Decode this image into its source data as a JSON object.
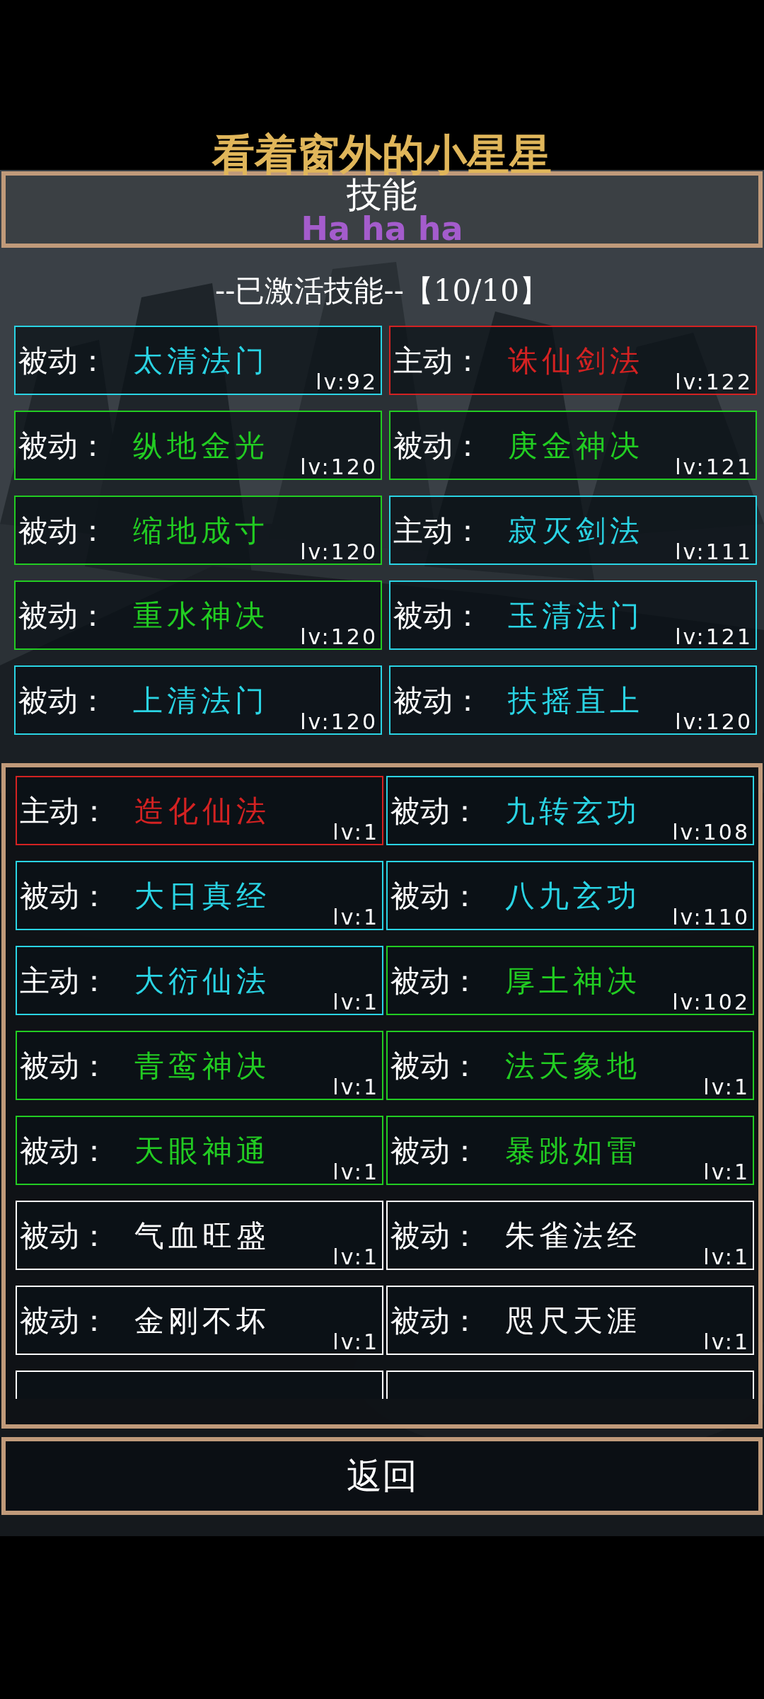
{
  "overlay_texts": [
    {
      "kind": "caption",
      "text": "看着窗外的小星星"
    },
    {
      "kind": "tag",
      "text": "Ha ha ha"
    }
  ],
  "title": "技能",
  "active_header": "--已激活技能--【10/10】",
  "active_skills": [
    {
      "type_label": "被动：",
      "name": "太清法门",
      "level_text": "lv:92",
      "color": "#2ad4e4"
    },
    {
      "type_label": "主动：",
      "name": "诛仙剑法",
      "level_text": "lv:122",
      "color": "#d42222"
    },
    {
      "type_label": "被动：",
      "name": "纵地金光",
      "level_text": "lv:120",
      "color": "#22cc22"
    },
    {
      "type_label": "被动：",
      "name": "庚金神决",
      "level_text": "lv:121",
      "color": "#22cc22"
    },
    {
      "type_label": "被动：",
      "name": "缩地成寸",
      "level_text": "lv:120",
      "color": "#22cc22"
    },
    {
      "type_label": "主动：",
      "name": "寂灭剑法",
      "level_text": "lv:111",
      "color": "#2ad4e4"
    },
    {
      "type_label": "被动：",
      "name": "重水神决",
      "level_text": "lv:120",
      "color": "#22cc22"
    },
    {
      "type_label": "被动：",
      "name": "玉清法门",
      "level_text": "lv:121",
      "color": "#2ad4e4"
    },
    {
      "type_label": "被动：",
      "name": "上清法门",
      "level_text": "lv:120",
      "color": "#2ad4e4"
    },
    {
      "type_label": "被动：",
      "name": "扶摇直上",
      "level_text": "lv:120",
      "color": "#2ad4e4"
    }
  ],
  "skill_list": [
    {
      "type_label": "主动：",
      "name": "造化仙法",
      "level_text": "lv:1",
      "color": "#d42222"
    },
    {
      "type_label": "被动：",
      "name": "九转玄功",
      "level_text": "lv:108",
      "color": "#2ad4e4"
    },
    {
      "type_label": "被动：",
      "name": "大日真经",
      "level_text": "lv:1",
      "color": "#2ad4e4"
    },
    {
      "type_label": "被动：",
      "name": "八九玄功",
      "level_text": "lv:110",
      "color": "#2ad4e4"
    },
    {
      "type_label": "主动：",
      "name": "大衍仙法",
      "level_text": "lv:1",
      "color": "#2ad4e4"
    },
    {
      "type_label": "被动：",
      "name": "厚土神决",
      "level_text": "lv:102",
      "color": "#22cc22"
    },
    {
      "type_label": "被动：",
      "name": "青鸾神决",
      "level_text": "lv:1",
      "color": "#22cc22"
    },
    {
      "type_label": "被动：",
      "name": "法天象地",
      "level_text": "lv:1",
      "color": "#22cc22"
    },
    {
      "type_label": "被动：",
      "name": "天眼神通",
      "level_text": "lv:1",
      "color": "#22cc22"
    },
    {
      "type_label": "被动：",
      "name": "暴跳如雷",
      "level_text": "lv:1",
      "color": "#22cc22"
    },
    {
      "type_label": "被动：",
      "name": "气血旺盛",
      "level_text": "lv:1",
      "color": "#ffffff"
    },
    {
      "type_label": "被动：",
      "name": "朱雀法经",
      "level_text": "lv:1",
      "color": "#ffffff"
    },
    {
      "type_label": "被动：",
      "name": "金刚不坏",
      "level_text": "lv:1",
      "color": "#ffffff"
    },
    {
      "type_label": "被动：",
      "name": "咫尺天涯",
      "level_text": "lv:1",
      "color": "#ffffff"
    }
  ],
  "cut_off_cards": [
    {
      "color": "#ffffff"
    },
    {
      "color": "#ffffff"
    }
  ],
  "back_button": "返回"
}
